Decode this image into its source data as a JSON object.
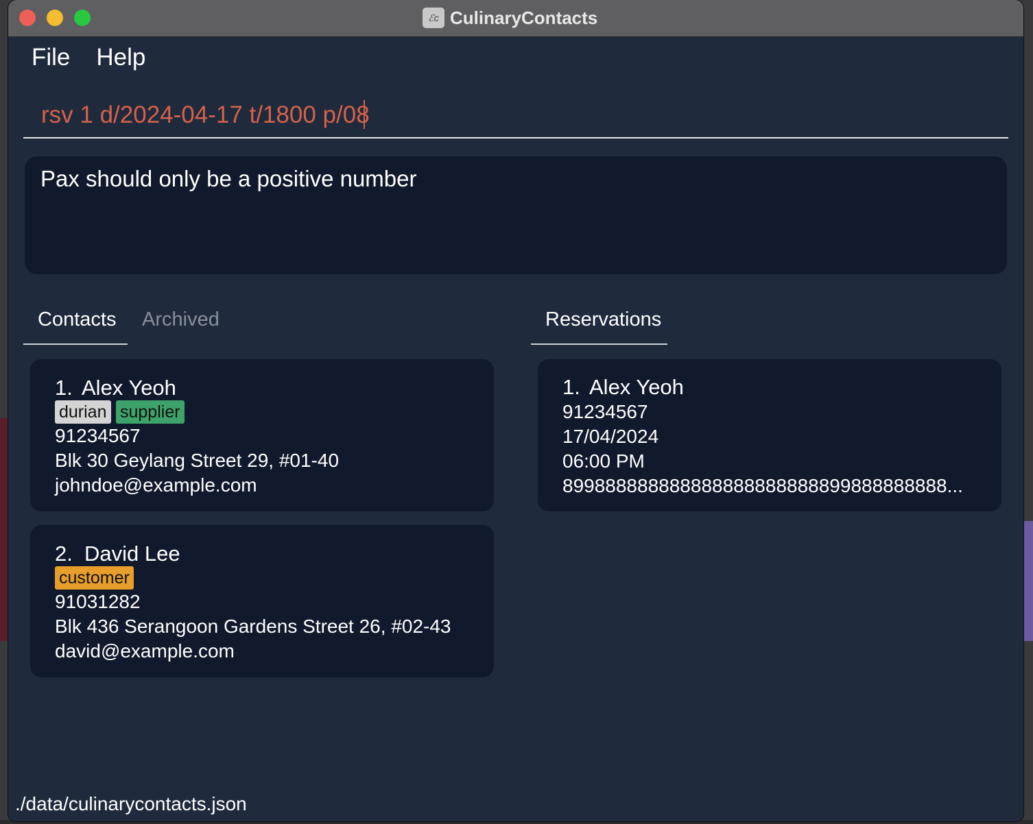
{
  "window": {
    "title": "CulinaryContacts",
    "app_icon_glyph": "ℰc"
  },
  "menu": {
    "file": "File",
    "help": "Help"
  },
  "command": {
    "value": "rsv 1 d/2024-04-17 t/1800 p/08"
  },
  "result": {
    "message": "Pax should only be a positive number"
  },
  "tabs": {
    "contacts": "Contacts",
    "archived": "Archived",
    "reservations": "Reservations"
  },
  "contacts": [
    {
      "index": "1.",
      "name": "Alex Yeoh",
      "tags": [
        {
          "label": "durian",
          "color": "#d4d4d4"
        },
        {
          "label": "supplier",
          "color": "#3ea36a"
        }
      ],
      "phone": "91234567",
      "address": "Blk 30 Geylang Street 29, #01-40",
      "email": "johndoe@example.com"
    },
    {
      "index": "2.",
      "name": "David Lee",
      "tags": [
        {
          "label": "customer",
          "color": "#e79e2a"
        }
      ],
      "phone": "91031282",
      "address": "Blk 436 Serangoon Gardens Street 26, #02-43",
      "email": "david@example.com"
    }
  ],
  "reservations": [
    {
      "index": "1.",
      "name": "Alex Yeoh",
      "phone": "91234567",
      "date": "17/04/2024",
      "time": "06:00 PM",
      "pax": "899888888888888888888888899888888888..."
    }
  ],
  "status": {
    "file_path": "./data/culinarycontacts.json"
  },
  "colors": {
    "command_text": "#d5624a",
    "window_bg": "#1f2a3c",
    "card_bg": "#111a2c"
  }
}
